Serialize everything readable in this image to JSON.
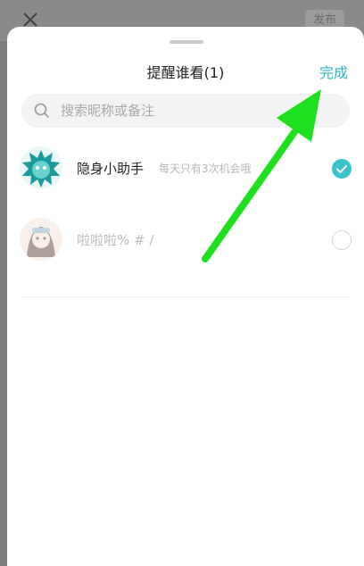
{
  "background": {
    "close_icon": "close-icon",
    "publish_label": "发布"
  },
  "sheet": {
    "title": "提醒谁看(1)",
    "done_label": "完成",
    "search_placeholder": "搜索昵称或备注"
  },
  "contacts": [
    {
      "name": "隐身小助手",
      "description": "每天只有3次机会哦",
      "selected": true,
      "enabled": true,
      "avatar_icon": "teal-star-avatar-icon"
    },
    {
      "name": "啦啦啦% # /",
      "selected": false,
      "enabled": false,
      "avatar_icon": "girl-avatar-icon"
    }
  ],
  "annotation": {
    "arrow_color": "#1ee01e"
  },
  "colors": {
    "accent": "#2bb7c9",
    "check": "#39c2cc"
  }
}
